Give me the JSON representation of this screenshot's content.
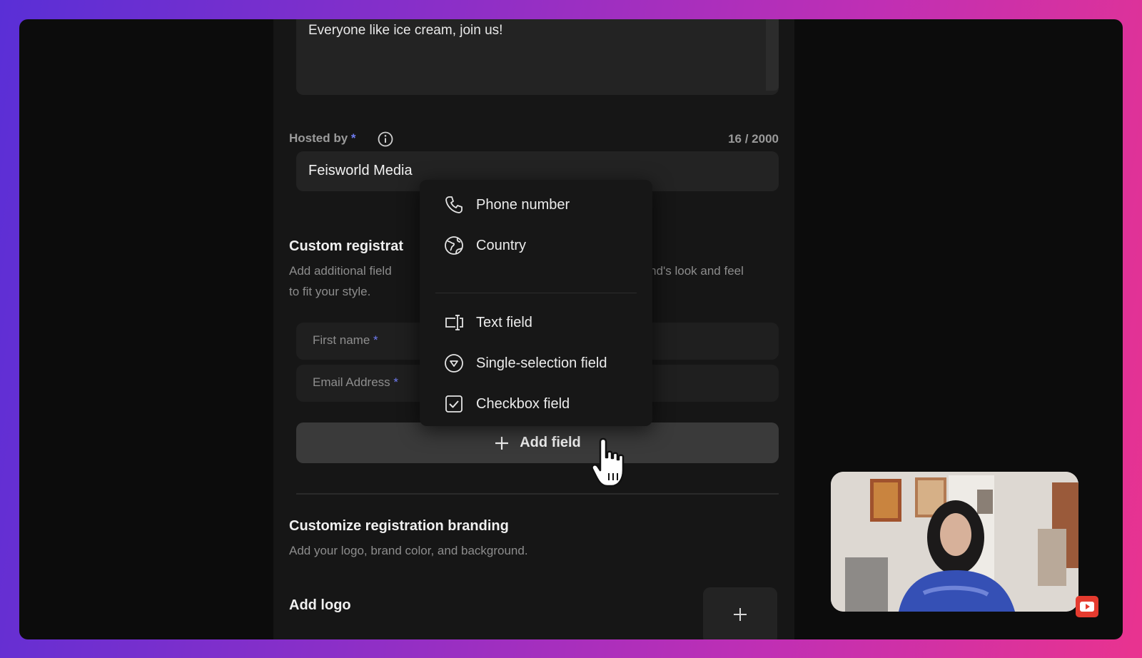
{
  "description": {
    "value": "Everyone like ice cream, join us!"
  },
  "hosted_by": {
    "label": "Hosted by",
    "required_mark": "*",
    "value": "Feisworld Media",
    "counter": "16 / 2000"
  },
  "custom_registration": {
    "title": "Custom registrat",
    "desc_line1": "Add additional field",
    "desc_line1_right": "rand's look and feel",
    "desc_line2": "to fit your style."
  },
  "fields": [
    {
      "label": "First name",
      "required_mark": "*"
    },
    {
      "label": "Email Address",
      "required_mark": "*"
    }
  ],
  "add_field": {
    "label": "Add field"
  },
  "branding": {
    "title": "Customize registration branding",
    "desc": "Add your logo, brand color, and background."
  },
  "add_logo": {
    "title": "Add logo"
  },
  "menu": {
    "items": [
      {
        "label": "Phone number",
        "icon": "phone-icon"
      },
      {
        "label": "Country",
        "icon": "globe-icon"
      },
      {
        "label": "Text field",
        "icon": "text-field-icon"
      },
      {
        "label": "Single-selection field",
        "icon": "dropdown-circle-icon"
      },
      {
        "label": "Checkbox field",
        "icon": "checkbox-icon"
      }
    ]
  },
  "colors": {
    "accent": "#6f7bf0",
    "panel": "#161616",
    "button": "#3a3a3a"
  }
}
